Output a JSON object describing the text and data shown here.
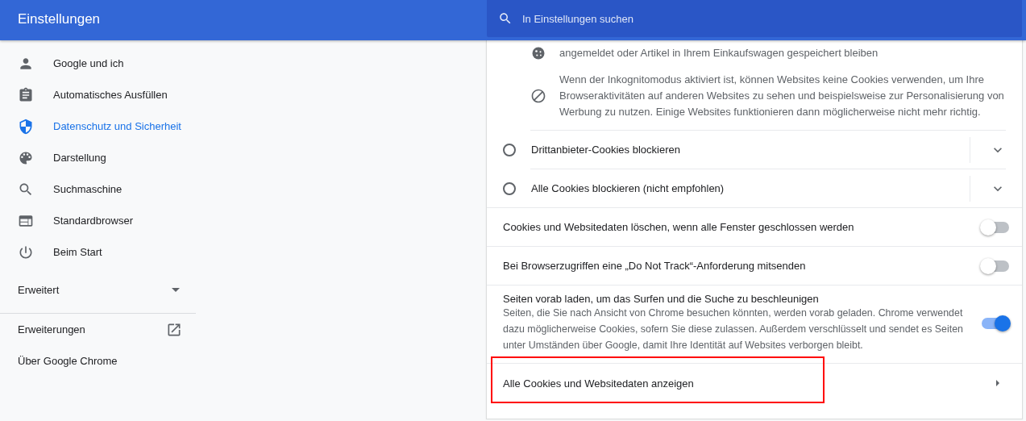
{
  "header": {
    "title": "Einstellungen",
    "search": {
      "placeholder": "In Einstellungen suchen"
    }
  },
  "sidebar": {
    "items": [
      {
        "label": "Google und ich",
        "selected": false
      },
      {
        "label": "Automatisches Ausfüllen",
        "selected": false
      },
      {
        "label": "Datenschutz und Sicherheit",
        "selected": true
      },
      {
        "label": "Darstellung",
        "selected": false
      },
      {
        "label": "Suchmaschine",
        "selected": false
      },
      {
        "label": "Standardbrowser",
        "selected": false
      },
      {
        "label": "Beim Start",
        "selected": false
      }
    ],
    "advanced": {
      "label": "Erweitert",
      "expanded": false
    },
    "links": [
      {
        "label": "Erweiterungen"
      },
      {
        "label": "Über Google Chrome"
      }
    ]
  },
  "cookie_settings": {
    "info": [
      {
        "text": "angemeldet oder Artikel in Ihrem Einkaufswagen gespeichert bleiben"
      },
      {
        "text": "Wenn der Inkognitomodus aktiviert ist, können Websites keine Cookies verwenden, um Ihre Browseraktivitäten auf anderen Websites zu sehen und beispielsweise zur Personalisierung von Werbung zu nutzen. Einige Websites funktionieren dann möglicherweise nicht mehr richtig."
      }
    ],
    "options": [
      {
        "label": "Drittanbieter-Cookies blockieren",
        "selected": false,
        "expanded": false
      },
      {
        "label": "Alle Cookies blockieren (nicht empfohlen)",
        "selected": false,
        "expanded": false
      }
    ],
    "toggles": [
      {
        "label": "Cookies und Websitedaten löschen, wenn alle Fenster geschlossen werden",
        "on": false
      },
      {
        "label": "Bei Browserzugriffen eine „Do Not Track“-Anforderung mitsenden",
        "on": false
      },
      {
        "label": "Seiten vorab laden, um das Surfen und die Suche zu beschleunigen",
        "description": "Seiten, die Sie nach Ansicht von Chrome besuchen könnten, werden vorab geladen. Chrome verwendet dazu möglicherweise Cookies, sofern Sie diese zulassen. Außerdem verschlüsselt und sendet es Seiten unter Umständen über Google, damit Ihre Identität auf Websites verborgen bleibt.",
        "on": true
      }
    ],
    "link_row": {
      "label": "Alle Cookies und Websitedaten anzeigen",
      "highlighted": true
    }
  }
}
